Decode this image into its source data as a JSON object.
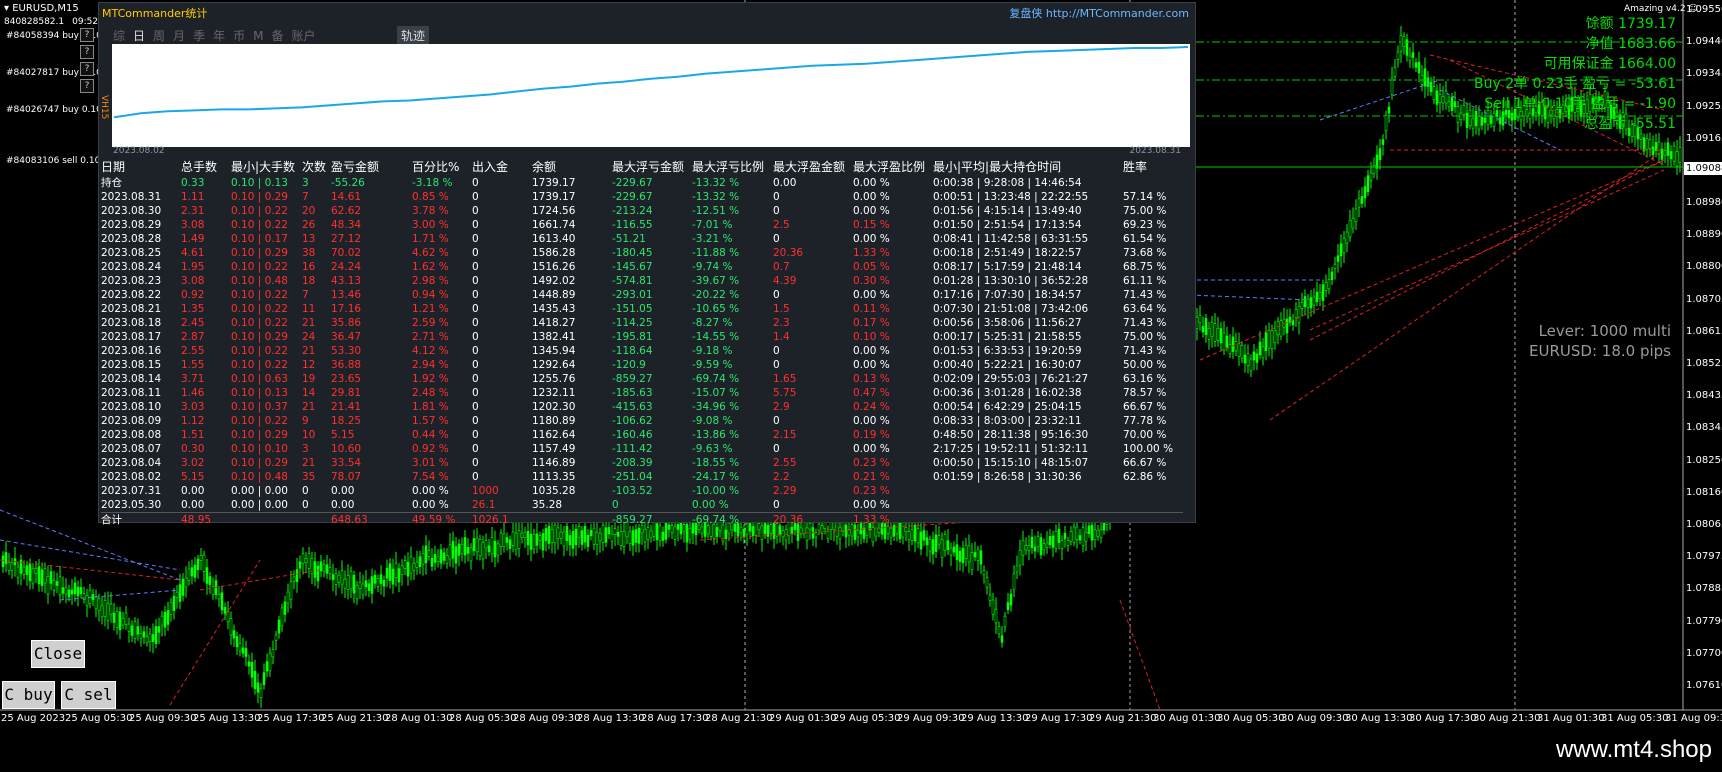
{
  "window": {
    "symbol": "EURUSD,M15",
    "account_number": "840828582.1",
    "time": "09:52:48"
  },
  "order_labels": [
    "#84058394 buy 0.10",
    "#84027817 buy 0.10",
    "#84026747 buy 0.10",
    "#84083106 sell 0.10"
  ],
  "side_buttons": [
    "?",
    "?",
    "?",
    "?"
  ],
  "info": {
    "balance": "馀额 1739.17",
    "equity": "净值 1683.66",
    "margin": "可用保证金 1664.00",
    "buy": "Buy 2单  0.23手 盈亏 = -53.61",
    "sell": "Sell 1单  0.10手 盈亏 = -1.90",
    "total": "总盈亏 -55.51",
    "version": "Amazing v4.2"
  },
  "lever": {
    "line1": "Lever: 1000 multi",
    "line2": "EURUSD: 18.0 pips"
  },
  "current_price": "1.09088",
  "price_axis": [
    "1.09550",
    "1.09440",
    "1.09345",
    "1.09255",
    "1.09165",
    "1.08980",
    "1.08890",
    "1.08800",
    "1.08705",
    "1.08615",
    "1.08525",
    "1.08435",
    "1.08345",
    "1.08250",
    "1.08160",
    "1.08065",
    "1.07975",
    "1.07885",
    "1.07790",
    "1.07700",
    "1.07610"
  ],
  "time_axis": [
    "25 Aug 2023",
    "25 Aug 05:30",
    "25 Aug 09:30",
    "25 Aug 13:30",
    "25 Aug 17:30",
    "25 Aug 21:30",
    "28 Aug 01:30",
    "28 Aug 05:30",
    "28 Aug 09:30",
    "28 Aug 13:30",
    "28 Aug 17:30",
    "28 Aug 21:30",
    "29 Aug 01:30",
    "29 Aug 05:30",
    "29 Aug 09:30",
    "29 Aug 13:30",
    "29 Aug 17:30",
    "29 Aug 21:30",
    "30 Aug 01:30",
    "30 Aug 05:30",
    "30 Aug 09:30",
    "30 Aug 13:30",
    "30 Aug 17:30",
    "30 Aug 21:30",
    "31 Aug 01:30",
    "31 Aug 05:30",
    "31 Aug 09:30"
  ],
  "panel": {
    "title": "MTCommander统计",
    "link": "复盘侠 http://MTCommander.com",
    "tabs": [
      "综",
      "日",
      "周",
      "月",
      "季",
      "年",
      "币",
      "M",
      "备",
      "账户"
    ],
    "active_tab": "日",
    "trace_tab": "轨迹",
    "equity_start": "2023.08.02",
    "equity_end": "2023.08.31",
    "equity_side_value": "VH15",
    "equity_curve": [
      0.72,
      0.68,
      0.66,
      0.65,
      0.64,
      0.64,
      0.63,
      0.62,
      0.6,
      0.58,
      0.56,
      0.55,
      0.53,
      0.51,
      0.49,
      0.46,
      0.43,
      0.41,
      0.38,
      0.36,
      0.33,
      0.31,
      0.28,
      0.26,
      0.24,
      0.22,
      0.2,
      0.19,
      0.18,
      0.16,
      0.14,
      0.12,
      0.1,
      0.08,
      0.06,
      0.05,
      0.04,
      0.03,
      0.02,
      0.02,
      0.01
    ]
  },
  "table": {
    "headers": [
      "日期",
      "总手数",
      "最小|大手数",
      "次数",
      "盈亏金额",
      "百分比%",
      "出入金",
      "余额",
      "最大浮亏金额",
      "最大浮亏比例",
      "最大浮盈金额",
      "最大浮盈比例",
      "最小|平均|最大持仓时间",
      "胜率"
    ],
    "rows": [
      [
        "持仓",
        "0.33",
        "0.10 | 0.13",
        "3",
        "-55.26",
        "-3.18 %",
        "0",
        "1739.17",
        "-229.67",
        "-13.32 %",
        "0.00",
        "0.00 %",
        "0:00:38 | 9:28:08 | 14:46:54",
        ""
      ],
      [
        "2023.08.31",
        "1.11",
        "0.10 | 0.29",
        "7",
        "14.61",
        "0.85 %",
        "0",
        "1739.17",
        "-229.67",
        "-13.32 %",
        "0",
        "0.00 %",
        "0:00:51 | 13:23:48 | 22:22:55",
        "57.14 %"
      ],
      [
        "2023.08.30",
        "2.31",
        "0.10 | 0.22",
        "20",
        "62.62",
        "3.78 %",
        "0",
        "1724.56",
        "-213.24",
        "-12.51 %",
        "0",
        "0.00 %",
        "0:01:56 | 4:15:14 | 13:49:40",
        "75.00 %"
      ],
      [
        "2023.08.29",
        "3.08",
        "0.10 | 0.22",
        "26",
        "48.34",
        "3.00 %",
        "0",
        "1661.74",
        "-116.55",
        "-7.01 %",
        "2.5",
        "0.15 %",
        "0:01:50 | 2:51:54 | 17:13:54",
        "69.23 %"
      ],
      [
        "2023.08.28",
        "1.49",
        "0.10 | 0.17",
        "13",
        "27.12",
        "1.71 %",
        "0",
        "1613.40",
        "-51.21",
        "-3.21 %",
        "0",
        "0.00 %",
        "0:08:41 | 11:42:58 | 63:31:55",
        "61.54 %"
      ],
      [
        "2023.08.25",
        "4.61",
        "0.10 | 0.29",
        "38",
        "70.02",
        "4.62 %",
        "0",
        "1586.28",
        "-180.45",
        "-11.88 %",
        "20.36",
        "1.33 %",
        "0:00:18 | 2:51:49 | 18:22:57",
        "73.68 %"
      ],
      [
        "2023.08.24",
        "1.95",
        "0.10 | 0.22",
        "16",
        "24.24",
        "1.62 %",
        "0",
        "1516.26",
        "-145.67",
        "-9.74 %",
        "0.7",
        "0.05 %",
        "0:08:17 | 5:17:59 | 21:48:14",
        "68.75 %"
      ],
      [
        "2023.08.23",
        "3.08",
        "0.10 | 0.48",
        "18",
        "43.13",
        "2.98 %",
        "0",
        "1492.02",
        "-574.81",
        "-39.67 %",
        "4.39",
        "0.30 %",
        "0:01:28 | 13:30:10 | 36:52:28",
        "61.11 %"
      ],
      [
        "2023.08.22",
        "0.92",
        "0.10 | 0.22",
        "7",
        "13.46",
        "0.94 %",
        "0",
        "1448.89",
        "-293.01",
        "-20.22 %",
        "0",
        "0.00 %",
        "0:17:16 | 7:07:30 | 18:34:57",
        "71.43 %"
      ],
      [
        "2023.08.21",
        "1.35",
        "0.10 | 0.22",
        "11",
        "17.16",
        "1.21 %",
        "0",
        "1435.43",
        "-151.05",
        "-10.65 %",
        "1.5",
        "0.11 %",
        "0:07:30 | 21:51:08 | 73:42:06",
        "63.64 %"
      ],
      [
        "2023.08.18",
        "2.45",
        "0.10 | 0.22",
        "21",
        "35.86",
        "2.59 %",
        "0",
        "1418.27",
        "-114.25",
        "-8.27 %",
        "2.3",
        "0.17 %",
        "0:00:56 | 3:58:06 | 11:56:27",
        "71.43 %"
      ],
      [
        "2023.08.17",
        "2.87",
        "0.10 | 0.29",
        "24",
        "36.47",
        "2.71 %",
        "0",
        "1382.41",
        "-195.81",
        "-14.55 %",
        "1.4",
        "0.10 %",
        "0:00:17 | 5:25:31 | 21:58:55",
        "75.00 %"
      ],
      [
        "2023.08.16",
        "2.55",
        "0.10 | 0.22",
        "21",
        "53.30",
        "4.12 %",
        "0",
        "1345.94",
        "-118.64",
        "-9.18 %",
        "0",
        "0.00 %",
        "0:01:53 | 6:33:53 | 19:20:59",
        "71.43 %"
      ],
      [
        "2023.08.15",
        "1.55",
        "0.10 | 0.22",
        "12",
        "36.88",
        "2.94 %",
        "0",
        "1292.64",
        "-120.9",
        "-9.59 %",
        "0",
        "0.00 %",
        "0:00:40 | 5:22:21 | 16:30:07",
        "50.00 %"
      ],
      [
        "2023.08.14",
        "3.71",
        "0.10 | 0.63",
        "19",
        "23.65",
        "1.92 %",
        "0",
        "1255.76",
        "-859.27",
        "-69.74 %",
        "1.65",
        "0.13 %",
        "0:02:09 | 29:55:03 | 76:21:27",
        "63.16 %"
      ],
      [
        "2023.08.11",
        "1.46",
        "0.10 | 0.13",
        "14",
        "29.81",
        "2.48 %",
        "0",
        "1232.11",
        "-185.63",
        "-15.07 %",
        "5.75",
        "0.47 %",
        "0:00:36 | 3:01:28 | 16:02:38",
        "78.57 %"
      ],
      [
        "2023.08.10",
        "3.03",
        "0.10 | 0.37",
        "21",
        "21.41",
        "1.81 %",
        "0",
        "1202.30",
        "-415.63",
        "-34.96 %",
        "2.9",
        "0.24 %",
        "0:00:54 | 6:42:29 | 25:04:15",
        "66.67 %"
      ],
      [
        "2023.08.09",
        "1.12",
        "0.10 | 0.22",
        "9",
        "18.25",
        "1.57 %",
        "0",
        "1180.89",
        "-106.62",
        "-9.08 %",
        "0",
        "0.00 %",
        "0:08:33 | 8:03:00 | 23:32:11",
        "77.78 %"
      ],
      [
        "2023.08.08",
        "1.51",
        "0.10 | 0.29",
        "10",
        "5.15",
        "0.44 %",
        "0",
        "1162.64",
        "-160.46",
        "-13.86 %",
        "2.15",
        "0.19 %",
        "0:48:50 | 28:11:38 | 95:16:30",
        "70.00 %"
      ],
      [
        "2023.08.07",
        "0.30",
        "0.10 | 0.10",
        "3",
        "10.60",
        "0.92 %",
        "0",
        "1157.49",
        "-111.42",
        "-9.63 %",
        "0",
        "0.00 %",
        "2:17:25 | 19:52:11 | 51:32:11",
        "100.00 %"
      ],
      [
        "2023.08.04",
        "3.02",
        "0.10 | 0.29",
        "21",
        "33.54",
        "3.01 %",
        "0",
        "1146.89",
        "-208.39",
        "-18.55 %",
        "2.55",
        "0.23 %",
        "0:00:50 | 15:15:10 | 48:15:07",
        "66.67 %"
      ],
      [
        "2023.08.02",
        "5.15",
        "0.10 | 0.48",
        "35",
        "78.07",
        "7.54 %",
        "0",
        "1113.35",
        "-251.04",
        "-24.17 %",
        "2.2",
        "0.21 %",
        "0:01:59 | 8:26:58 | 31:30:36",
        "62.86 %"
      ],
      [
        "2023.07.31",
        "0.00",
        "0.00 | 0.00",
        "0",
        "0.00",
        "0.00 %",
        "1000",
        "1035.28",
        "-103.52",
        "-10.00 %",
        "2.29",
        "0.23 %",
        "",
        ""
      ],
      [
        "2023.05.30",
        "0.00",
        "0.00 | 0.00",
        "0",
        "0.00",
        "0.00 %",
        "26.1",
        "35.28",
        "0",
        "0.00 %",
        "0",
        "0.00 %",
        "",
        ""
      ]
    ],
    "total": [
      "合计",
      "48.95",
      "",
      "",
      "648.63",
      "49.59 %",
      "1026.1",
      "",
      "-859.27",
      "-69.74 %",
      "20.36",
      "1.33 %",
      "",
      ""
    ]
  },
  "buttons": {
    "close": "Close",
    "cbuy": "C buy",
    "csell": "C sel"
  },
  "watermark": "www.mt4.shop"
}
